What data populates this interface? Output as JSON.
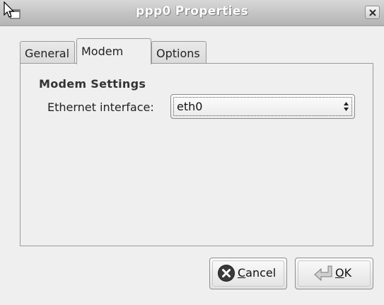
{
  "window": {
    "title": "ppp0 Properties",
    "close_icon": "close-icon"
  },
  "tabs": [
    {
      "label": "General",
      "active": false
    },
    {
      "label": "Modem",
      "active": true
    },
    {
      "label": "Options",
      "active": false
    }
  ],
  "panel": {
    "section_title": "Modem Settings",
    "ethernet_label": "Ethernet interface:",
    "ethernet_value": "eth0"
  },
  "buttons": {
    "cancel_label": "Cancel",
    "ok_label": "OK"
  },
  "colors": {
    "window_bg": "#efefef",
    "cancel_icon": "#3a3a3a",
    "ok_arrow": "#d0d0d0"
  }
}
